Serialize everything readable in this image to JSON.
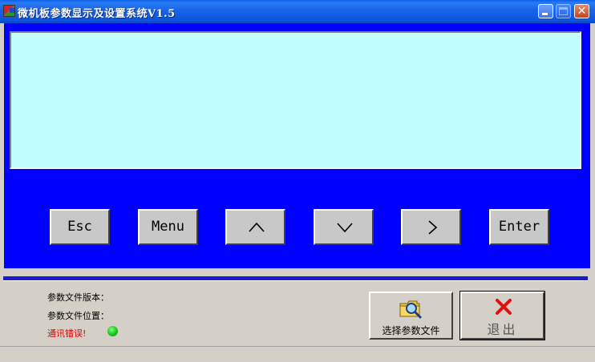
{
  "window": {
    "title": "微机板参数显示及设置系统V1.5"
  },
  "display_panel": {
    "text": ""
  },
  "keypad": {
    "esc_label": "Esc",
    "menu_label": "Menu",
    "up_icon": "chevron-up-icon",
    "down_icon": "chevron-down-icon",
    "right_icon": "chevron-right-icon",
    "enter_label": "Enter"
  },
  "info": {
    "file_version_label": "参数文件版本：",
    "file_location_label": "参数文件位置：",
    "comm_error_label": "通讯错误!",
    "comm_status_color": "#10c010"
  },
  "actions": {
    "select_file_label": "选择参数文件",
    "exit_label": "退出"
  },
  "colors": {
    "panel_blue": "#0000ff",
    "display_cyan": "#c0ffff",
    "error_red": "#e00000"
  }
}
